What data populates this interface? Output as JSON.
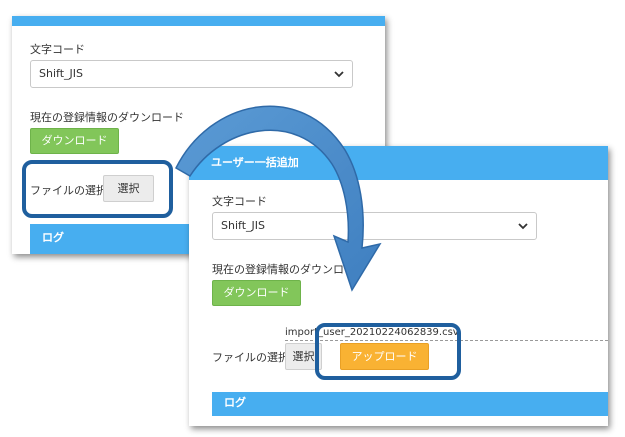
{
  "back_panel": {
    "charset_label": "文字コード",
    "charset_value": "Shift_JIS",
    "download_label": "現在の登録情報のダウンロード",
    "download_button": "ダウンロード",
    "file_select_label": "ファイルの選択:",
    "select_button": "選択",
    "log_label": "ログ"
  },
  "front_panel": {
    "title": "ユーザー一括追加",
    "charset_label": "文字コード",
    "charset_value": "Shift_JIS",
    "download_label": "現在の登録情報のダウンロード",
    "download_button": "ダウンロード",
    "file_select_label": "ファイルの選択:",
    "filename": "import_user_20210224062839.csv",
    "select_button": "選択",
    "upload_button": "アップロード",
    "log_label": "ログ"
  },
  "colors": {
    "header_blue": "#47aef0",
    "green": "#82c65a",
    "orange": "#f9b233",
    "highlight": "#1f5f9e"
  },
  "icons": [
    "chevron-down-icon",
    "curved-arrow-icon"
  ]
}
